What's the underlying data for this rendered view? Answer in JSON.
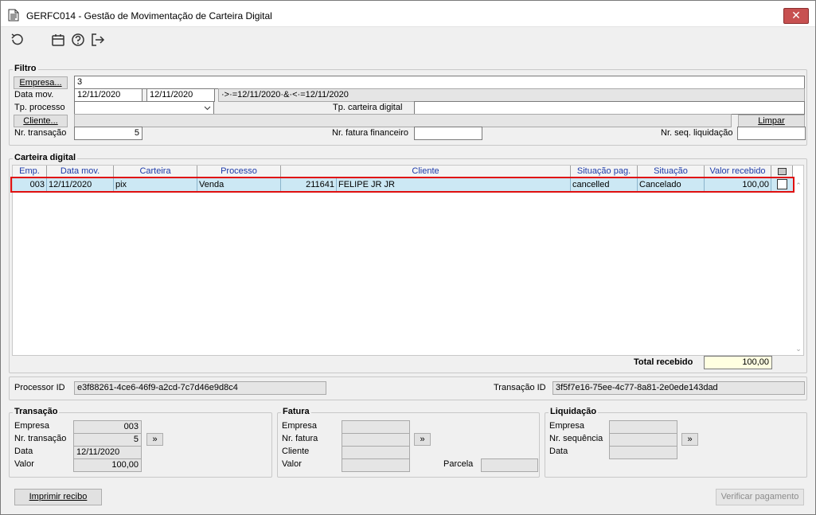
{
  "window": {
    "title": "GERFC014 - Gestão de Movimentação de Carteira Digital",
    "close_label": "✕"
  },
  "toolbar": {
    "icons": [
      "refresh-icon",
      "calendar-icon",
      "help-icon",
      "exit-icon"
    ]
  },
  "filtro": {
    "title": "Filtro",
    "empresa_button": "Empresa...",
    "empresa_value": "3",
    "data_mov_label": "Data mov.",
    "data_mov_from": "12/11/2020",
    "data_mov_to": "12/11/2020",
    "data_mov_expr": "·>·=12/11/2020·&·<·=12/11/2020",
    "tp_processo_label": "Tp. processo",
    "tp_processo_value": "",
    "tp_carteira_label": "Tp. carteira digital",
    "tp_carteira_value": "",
    "cliente_button": "Cliente...",
    "cliente_value": "",
    "limpar_button": "Limpar",
    "nr_transacao_label": "Nr. transação",
    "nr_transacao_value": "5",
    "nr_fatura_label": "Nr. fatura financeiro",
    "nr_fatura_value": "",
    "nr_seq_label": "Nr. seq. liquidação",
    "nr_seq_value": ""
  },
  "carteira": {
    "title": "Carteira digital",
    "columns": [
      "Emp.",
      "Data mov.",
      "Carteira",
      "Processo",
      "Cliente",
      "Situação pag.",
      "Situação",
      "Valor recebido"
    ],
    "rows": [
      {
        "emp": "003",
        "data_mov": "12/11/2020",
        "carteira": "pix",
        "processo": "Venda",
        "cliente_code": "211641",
        "cliente_name": "FELIPE JR JR",
        "situacao_pag": "cancelled",
        "situacao": "Cancelado",
        "valor": "100,00"
      }
    ],
    "total_label": "Total recebido",
    "total_value": "100,00"
  },
  "ids": {
    "processor_label": "Processor ID",
    "processor_value": "e3f88261-4ce6-46f9-a2cd-7c7d46e9d8c4",
    "transacao_label": "Transação ID",
    "transacao_value": "3f5f7e16-75ee-4c77-8a81-2e0ede143dad"
  },
  "transacao": {
    "title": "Transação",
    "empresa_label": "Empresa",
    "empresa_value": "003",
    "nr_transacao_label": "Nr. transação",
    "nr_transacao_value": "5",
    "data_label": "Data",
    "data_value": "12/11/2020",
    "valor_label": "Valor",
    "valor_value": "100,00",
    "go_button": "»"
  },
  "fatura": {
    "title": "Fatura",
    "empresa_label": "Empresa",
    "nr_fatura_label": "Nr. fatura",
    "cliente_label": "Cliente",
    "valor_label": "Valor",
    "parcela_label": "Parcela",
    "go_button": "»"
  },
  "liquidacao": {
    "title": "Liquidação",
    "empresa_label": "Empresa",
    "nr_sequencia_label": "Nr. sequência",
    "data_label": "Data",
    "go_button": "»"
  },
  "footer": {
    "imprimir_button": "Imprimir recibo",
    "verificar_button": "Verificar pagamento"
  }
}
